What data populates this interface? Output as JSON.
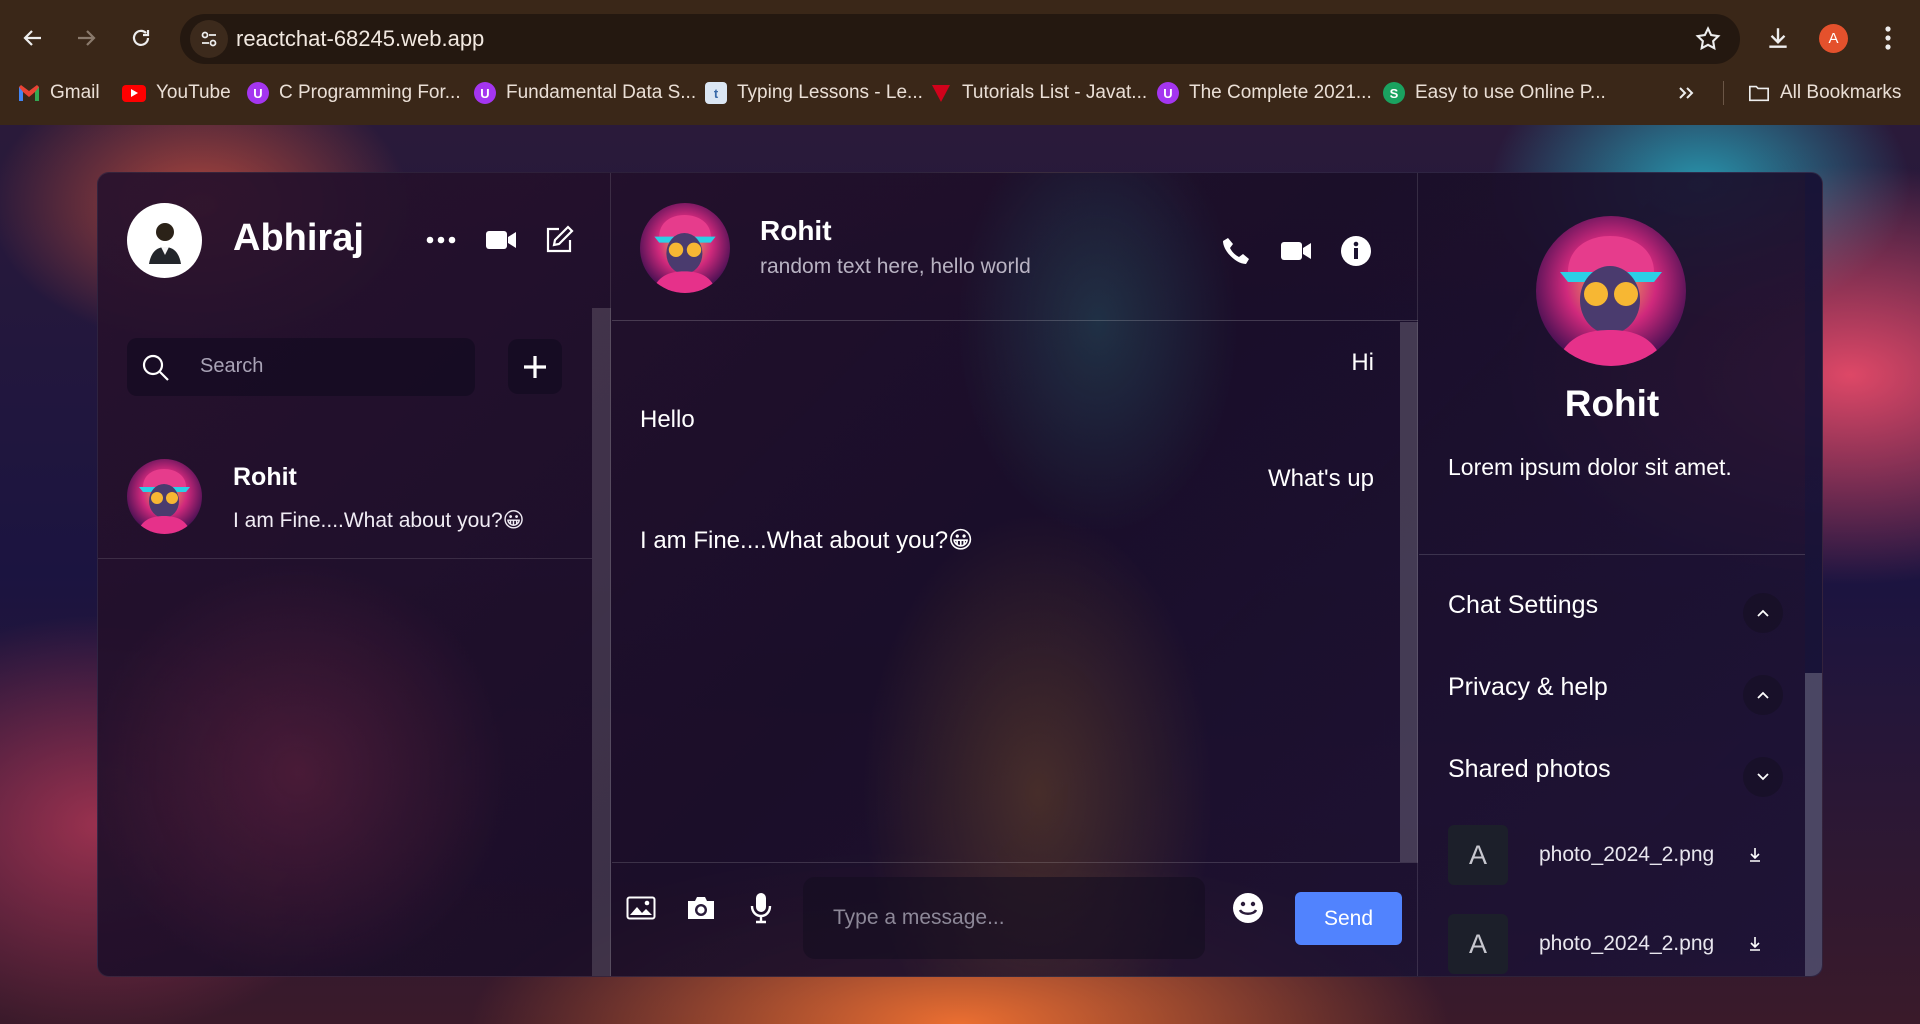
{
  "browser": {
    "url": "reactchat-68245.web.app",
    "profile_initial": "A",
    "bookmarks": [
      {
        "label": "Gmail",
        "icon": "gmail-icon",
        "color": "#ea4335"
      },
      {
        "label": "YouTube",
        "icon": "youtube-icon",
        "color": "#ff0000"
      },
      {
        "label": "C Programming For...",
        "icon": "udemy-icon",
        "color": "#a435f0"
      },
      {
        "label": "Fundamental Data S...",
        "icon": "udemy-icon",
        "color": "#a435f0"
      },
      {
        "label": "Typing Lessons - Le...",
        "icon": "typing-icon",
        "color": "#4a90d9"
      },
      {
        "label": "Tutorials List - Javat...",
        "icon": "javatpoint-icon",
        "color": "#d0021b"
      },
      {
        "label": "The Complete 2021...",
        "icon": "udemy-icon",
        "color": "#a435f0"
      },
      {
        "label": "Easy to use Online P...",
        "icon": "s-icon",
        "color": "#1aa260"
      }
    ],
    "all_bookmarks": "All Bookmarks"
  },
  "sidebar": {
    "user_name": "Abhiraj",
    "search_placeholder": "Search",
    "chats": [
      {
        "name": "Rohit",
        "last_message": "I am Fine....What about you?😀"
      }
    ]
  },
  "chat": {
    "name": "Rohit",
    "status": "random text here, hello world",
    "messages": [
      {
        "text": "Hi",
        "own": true
      },
      {
        "text": "Hello",
        "own": false
      },
      {
        "text": "What's up",
        "own": true
      },
      {
        "text": "I am Fine....What about you?😀",
        "own": false
      }
    ],
    "input_placeholder": "Type a message...",
    "send_label": "Send",
    "emoji": "😀",
    "send_color": "#5183fe"
  },
  "details": {
    "name": "Rohit",
    "bio": "Lorem ipsum dolor sit amet.",
    "options": [
      {
        "label": "Chat Settings",
        "expanded": false
      },
      {
        "label": "Privacy & help",
        "expanded": false
      },
      {
        "label": "Shared photos",
        "expanded": true
      }
    ],
    "photos": [
      {
        "thumb_letter": "A",
        "filename": "photo_2024_2.png"
      },
      {
        "thumb_letter": "A",
        "filename": "photo_2024_2.png"
      }
    ]
  }
}
